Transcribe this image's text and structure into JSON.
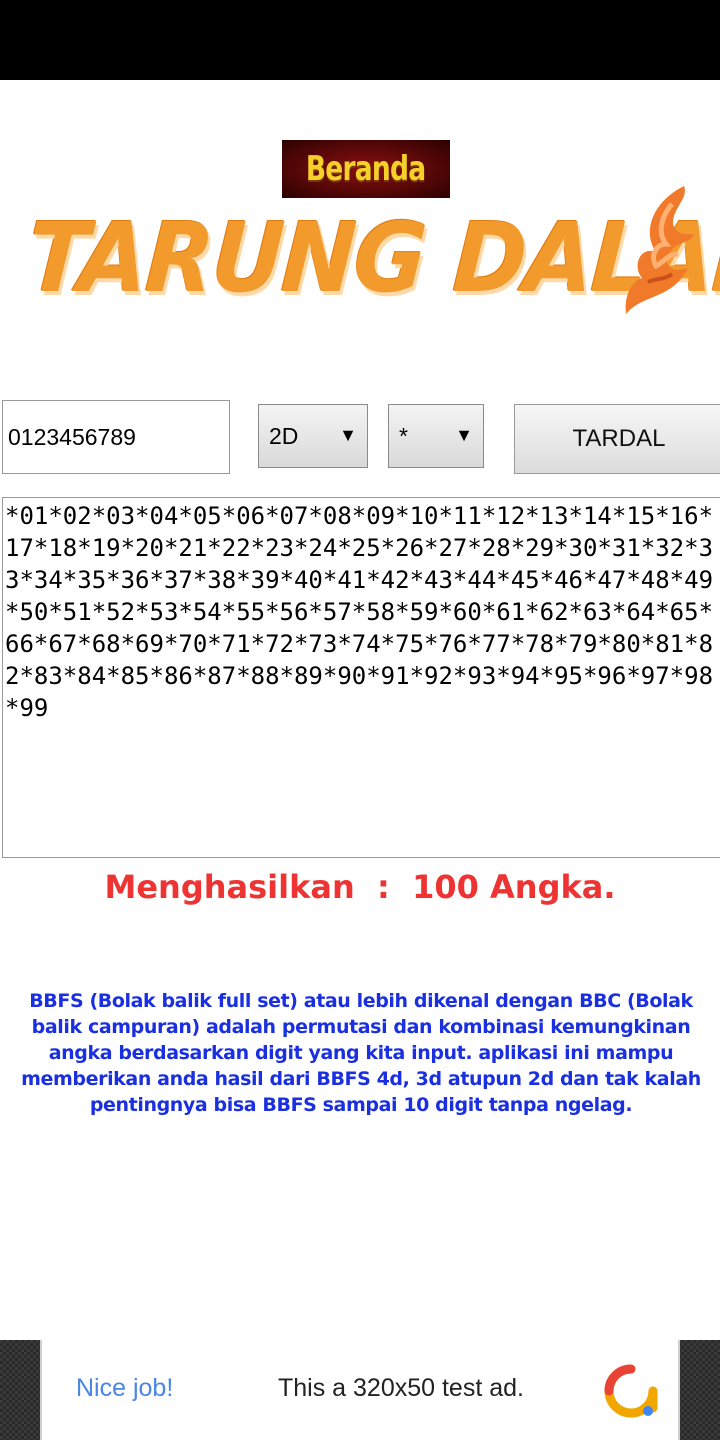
{
  "header": {
    "home_badge_label": "Beranda",
    "logo_text": "TARUNG DALAM"
  },
  "form": {
    "digits_value": "0123456789",
    "mode_select_value": "2D",
    "separator_select_value": "*",
    "submit_label": "TARDAL",
    "dropdown_arrow": "▼"
  },
  "result": {
    "text": "*01*02*03*04*05*06*07*08*09*10*11*12*13*14*15*16*17*18*19*20*21*22*23*24*25*26*27*28*29*30*31*32*33*34*35*36*37*38*39*40*41*42*43*44*45*46*47*48*49*50*51*52*53*54*55*56*57*58*59*60*61*62*63*64*65*66*67*68*69*70*71*72*73*74*75*76*77*78*79*80*81*82*83*84*85*86*87*88*89*90*91*92*93*94*95*96*97*98*99",
    "count_text": "Menghasilkan  :  100 Angka."
  },
  "description": "BBFS (Bolak balik full set) atau lebih dikenal dengan BBC (Bolak balik campuran) adalah permutasi dan kombinasi kemungkinan angka berdasarkan digit yang kita input. aplikasi ini mampu memberikan anda hasil dari BBFS 4d, 3d atupun 2d dan tak kalah pentingnya bisa BBFS sampai 10 digit tanpa ngelag.",
  "ad": {
    "nice_text": "Nice job!",
    "message": "This a 320x50 test ad.",
    "logo_icon": "google-ads-icon"
  },
  "colors": {
    "logo_orange": "#f39a2c",
    "count_red": "#ee3333",
    "description_blue": "#1a2fe0",
    "ad_link_blue": "#4a86e8"
  }
}
